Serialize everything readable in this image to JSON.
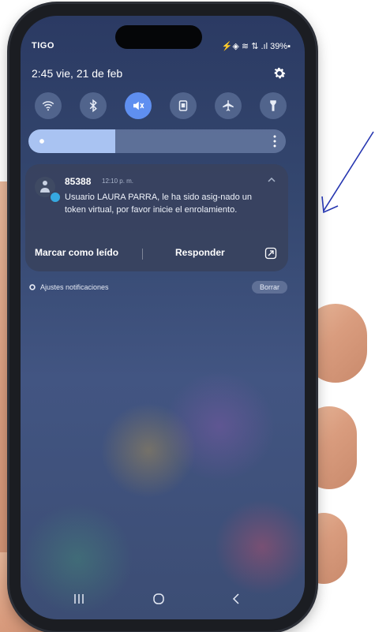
{
  "status_bar": {
    "carrier": "TIGO",
    "indicators": "⚡◈ ≋ ⇅ .ıl 39%▪"
  },
  "quick_panel": {
    "datetime": "2:45  vie, 21 de feb",
    "toggles": [
      "wifi-icon",
      "bluetooth-icon",
      "sound-mute-icon",
      "screen-icon",
      "airplane-icon",
      "flashlight-icon"
    ],
    "active_toggle": "sound-mute-icon",
    "brightness_level": 0.337
  },
  "notification": {
    "sender": "85388",
    "time": "12:10 p. m.",
    "body": "Usuario LAURA PARRA, le ha sido asig-nado un token virtual, por favor inicie el enrolamiento.",
    "actions": {
      "mark_read": "Marcar como leído",
      "reply": "Responder"
    }
  },
  "footer": {
    "settings_label": "Ajustes notificaciones",
    "clear_label": "Borrar"
  },
  "colors": {
    "accent": "#5f8ff0",
    "annotation_arrow": "#2535b0"
  }
}
